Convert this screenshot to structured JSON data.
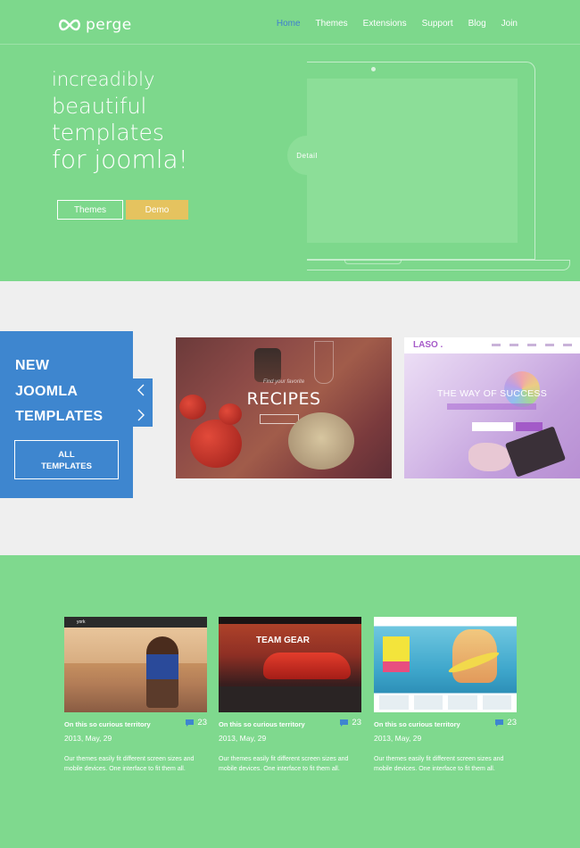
{
  "brand": {
    "name": "perge"
  },
  "nav": {
    "items": [
      {
        "label": "Home",
        "active": true
      },
      {
        "label": "Themes",
        "active": false
      },
      {
        "label": "Extensions",
        "active": false
      },
      {
        "label": "Support",
        "active": false
      },
      {
        "label": "Blog",
        "active": false
      },
      {
        "label": "Join",
        "active": false
      }
    ]
  },
  "hero": {
    "headline": [
      "increadibly",
      "beautiful",
      "templates",
      "for joomla!"
    ],
    "themes_button": "Themes",
    "demo_button": "Demo",
    "detail_button": "Detail"
  },
  "templates_band": {
    "title_lines": [
      "NEW",
      "JOOMLA",
      "TEMPLATES"
    ],
    "all_button_lines": [
      "ALL",
      "TEMPLATES"
    ],
    "cards": [
      {
        "name": "RECIPES",
        "subtitle": "Find your favorite"
      },
      {
        "logo": "LASO .",
        "headline": "THE WAY OF SUCCESS"
      }
    ]
  },
  "blog": {
    "posts": [
      {
        "title": "On this so curious territory",
        "comments": "23",
        "date": "2013, May, 29",
        "text": "Our themes easily fit different screen sizes and mobile devices. One interface to fit them all.",
        "thumb_label": "york"
      },
      {
        "title": "On this so curious territory",
        "comments": "23",
        "date": "2013, May, 29",
        "text": "Our themes easily fit different screen sizes and mobile devices. One interface to fit them all.",
        "thumb_label": "TEAM GEAR"
      },
      {
        "title": "On this so curious territory",
        "comments": "23",
        "date": "2013, May, 29",
        "text": "Our themes easily fit different screen sizes and mobile devices. One interface to fit them all.",
        "thumb_label": "WELCOME TO SURFHOUSE"
      }
    ]
  },
  "colors": {
    "green": "#7dd88c",
    "blue": "#3e86cf",
    "yellow": "#e5c35f",
    "band": "#efefef"
  },
  "icons": {
    "logo": "infinity-icon",
    "prev": "chevron-left-icon",
    "next": "chevron-right-icon",
    "comment": "comment-icon"
  }
}
